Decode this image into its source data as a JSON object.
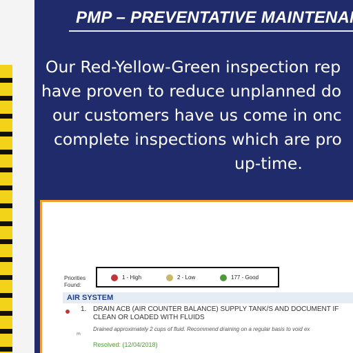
{
  "header": {
    "title": "PMP – PREVENTATIVE MAINTENANC"
  },
  "intro": {
    "lines": [
      "Our Red-Yellow-Green inspection rep",
      "have proven to reduce unplanned do",
      "our customers have us come in onc",
      "complete inspections which are pro",
      "up-time."
    ]
  },
  "report": {
    "priorities_label": "Priorities\nFound:",
    "priorities": [
      {
        "label": "1 - High",
        "color": "#c0353a"
      },
      {
        "label": "2 - Low",
        "color": "#c9b86a"
      },
      {
        "label": "177 - Good",
        "color": "#4e9a3a"
      }
    ],
    "section": "AIR SYSTEM",
    "item": {
      "number": "1.",
      "text": "DRAIN ACB (AIR COUNTER BALANCE) SUPPLY TANK/S AND DOCUMENT IF CLEAN OR LOADED WITH FLUIDS",
      "note": "Drained approximately 2 cups of fluid.  Recommend draining on a regular basis to void ex",
      "mini": "m",
      "resolved": "Resolved: (12/04/2018)"
    }
  },
  "colors": {
    "panel": "#1f2b6b",
    "accent_border": "#f0a033",
    "stripe_yellow": "#f3d21a"
  }
}
